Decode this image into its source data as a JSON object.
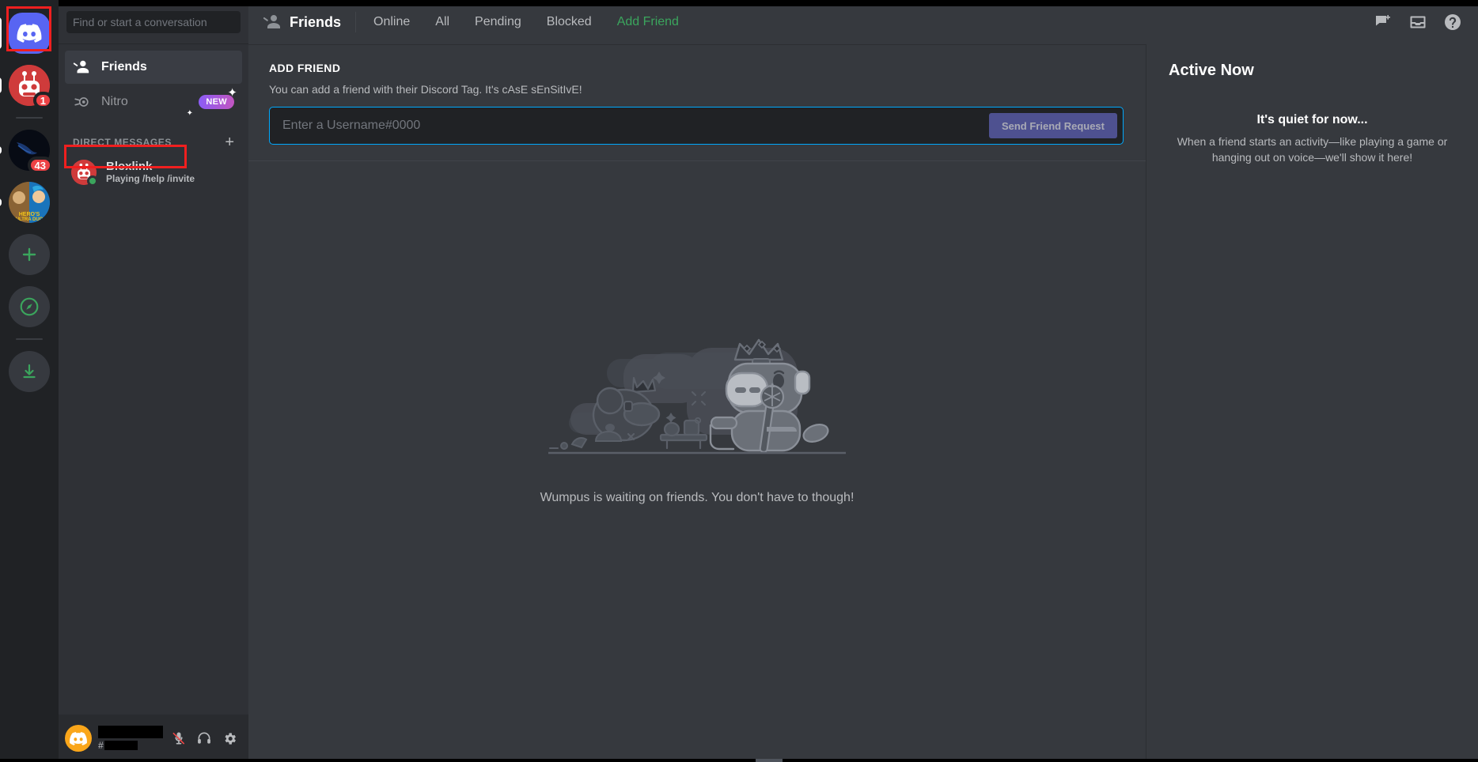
{
  "colors": {
    "brand": "#5865f2",
    "accent_green": "#3ba55d",
    "danger_red": "#ed4245",
    "highlight_red": "#f01f1f",
    "input_focus": "#00a8fc",
    "rail_bg": "#202225",
    "sidebar_bg": "#2f3136",
    "main_bg": "#36393e"
  },
  "server_rail": {
    "items": [
      {
        "name": "home",
        "label": "Home",
        "icon": "discord-logo-icon",
        "badge": "",
        "selected": true
      },
      {
        "name": "bloxlink-server",
        "label": "Bloxlink",
        "icon": "robot-avatar-icon",
        "badge": "1",
        "selected": false
      },
      {
        "name": "kali-server",
        "label": "Kali",
        "icon": "dragon-avatar-icon",
        "badge": "43",
        "selected": false
      },
      {
        "name": "anime-server",
        "label": "Hero's Ultra Duo",
        "icon": "anime-avatar-icon",
        "badge": "",
        "selected": false
      }
    ],
    "actions": [
      {
        "name": "add-server",
        "label": "Add a Server",
        "icon": "plus-icon"
      },
      {
        "name": "explore-servers",
        "label": "Explore Public Servers",
        "icon": "compass-icon"
      },
      {
        "name": "download-apps",
        "label": "Download Apps",
        "icon": "download-icon"
      }
    ]
  },
  "sidebar": {
    "search": {
      "placeholder": "Find or start a conversation",
      "value": ""
    },
    "nav": [
      {
        "name": "friends",
        "label": "Friends",
        "icon": "friends-icon",
        "active": true
      },
      {
        "name": "nitro",
        "label": "Nitro",
        "icon": "nitro-icon",
        "badge": "NEW",
        "active": false
      }
    ],
    "dm_header": {
      "title": "DIRECT MESSAGES",
      "add_label": "+"
    },
    "dms": [
      {
        "name": "bloxlink",
        "title": "Bloxlink",
        "subtitle": "Playing /help /invite",
        "status": "online"
      }
    ],
    "user_panel": {
      "username": "",
      "hash": "#",
      "discriminator": "",
      "buttons": [
        {
          "name": "mute-button",
          "label": "Mute",
          "icon": "mic-muted-icon",
          "state": "muted"
        },
        {
          "name": "deafen-button",
          "label": "Deafen",
          "icon": "headphones-icon",
          "state": "on"
        },
        {
          "name": "user-settings-button",
          "label": "User Settings",
          "icon": "gear-icon",
          "state": "on"
        }
      ]
    }
  },
  "topbar": {
    "title": "Friends",
    "tabs": [
      {
        "name": "tab-online",
        "label": "Online",
        "active": false,
        "accent": false
      },
      {
        "name": "tab-all",
        "label": "All",
        "active": false,
        "accent": false
      },
      {
        "name": "tab-pending",
        "label": "Pending",
        "active": false,
        "accent": false
      },
      {
        "name": "tab-blocked",
        "label": "Blocked",
        "active": false,
        "accent": false
      },
      {
        "name": "tab-add-friend",
        "label": "Add Friend",
        "active": true,
        "accent": true
      }
    ],
    "right_icons": [
      {
        "name": "new-group-dm-icon",
        "label": "New Group DM"
      },
      {
        "name": "inbox-icon",
        "label": "Inbox"
      },
      {
        "name": "help-icon",
        "label": "Help"
      }
    ]
  },
  "add_friend": {
    "heading": "ADD FRIEND",
    "description": "You can add a friend with their Discord Tag. It's cAsE sEnSitIvE!",
    "input_placeholder": "Enter a Username#0000",
    "input_value": "",
    "button_label": "Send Friend Request"
  },
  "empty_state": {
    "caption": "Wumpus is waiting on friends. You don't have to though!",
    "illustration": "wumpus-waiting-illustration"
  },
  "active_now": {
    "title": "Active Now",
    "empty_title": "It's quiet for now...",
    "empty_body": "When a friend starts an activity—like playing a game or hanging out on voice—we'll show it here!"
  },
  "annotations": [
    {
      "name": "highlight-home-server",
      "target": "home server button"
    },
    {
      "name": "highlight-direct-messages",
      "target": "DIRECT MESSAGES header"
    }
  ]
}
